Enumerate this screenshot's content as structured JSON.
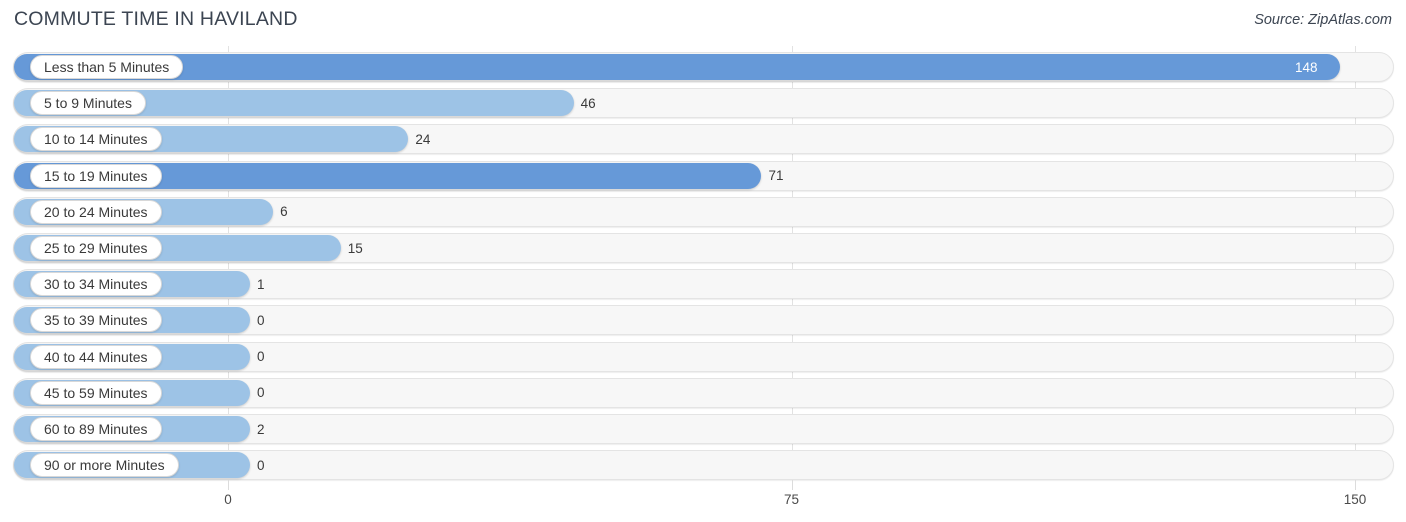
{
  "header": {
    "title": "COMMUTE TIME IN HAVILAND",
    "source": "Source: ZipAtlas.com"
  },
  "colors": {
    "bar_primary": "#6699d8",
    "bar_secondary": "#9dc3e6",
    "track_bg": "#f7f7f7",
    "track_border": "#e4e4e4",
    "gridline": "#e2e2e2",
    "text": "#3a3a3a",
    "value_inside": "#ffffff"
  },
  "chart_data": {
    "type": "bar",
    "orientation": "horizontal",
    "title": "COMMUTE TIME IN HAVILAND",
    "xlabel": "",
    "ylabel": "",
    "xlim": [
      0,
      150
    ],
    "xticks": [
      "0",
      "75",
      "150"
    ],
    "xtick_values": [
      0,
      75,
      150
    ],
    "grid": true,
    "legend": false,
    "categories": [
      "Less than 5 Minutes",
      "5 to 9 Minutes",
      "10 to 14 Minutes",
      "15 to 19 Minutes",
      "20 to 24 Minutes",
      "25 to 29 Minutes",
      "30 to 34 Minutes",
      "35 to 39 Minutes",
      "40 to 44 Minutes",
      "45 to 59 Minutes",
      "60 to 89 Minutes",
      "90 or more Minutes"
    ],
    "values": [
      148,
      46,
      24,
      71,
      6,
      15,
      1,
      0,
      0,
      0,
      2,
      0
    ],
    "value_labels": [
      "148",
      "46",
      "24",
      "71",
      "6",
      "15",
      "1",
      "0",
      "0",
      "0",
      "2",
      "0"
    ]
  },
  "rows": [
    {
      "label": "Less than 5 Minutes",
      "value": 148,
      "value_label": "148",
      "inside": true,
      "color_key": "bar_primary"
    },
    {
      "label": "5 to 9 Minutes",
      "value": 46,
      "value_label": "46",
      "inside": false,
      "color_key": "bar_secondary"
    },
    {
      "label": "10 to 14 Minutes",
      "value": 24,
      "value_label": "24",
      "inside": false,
      "color_key": "bar_secondary"
    },
    {
      "label": "15 to 19 Minutes",
      "value": 71,
      "value_label": "71",
      "inside": false,
      "color_key": "bar_primary"
    },
    {
      "label": "20 to 24 Minutes",
      "value": 6,
      "value_label": "6",
      "inside": false,
      "color_key": "bar_secondary"
    },
    {
      "label": "25 to 29 Minutes",
      "value": 15,
      "value_label": "15",
      "inside": false,
      "color_key": "bar_secondary"
    },
    {
      "label": "30 to 34 Minutes",
      "value": 1,
      "value_label": "1",
      "inside": false,
      "color_key": "bar_secondary"
    },
    {
      "label": "35 to 39 Minutes",
      "value": 0,
      "value_label": "0",
      "inside": false,
      "color_key": "bar_secondary"
    },
    {
      "label": "40 to 44 Minutes",
      "value": 0,
      "value_label": "0",
      "inside": false,
      "color_key": "bar_secondary"
    },
    {
      "label": "45 to 59 Minutes",
      "value": 0,
      "value_label": "0",
      "inside": false,
      "color_key": "bar_secondary"
    },
    {
      "label": "60 to 89 Minutes",
      "value": 2,
      "value_label": "2",
      "inside": false,
      "color_key": "bar_secondary"
    },
    {
      "label": "90 or more Minutes",
      "value": 0,
      "value_label": "0",
      "inside": false,
      "color_key": "bar_secondary"
    }
  ]
}
